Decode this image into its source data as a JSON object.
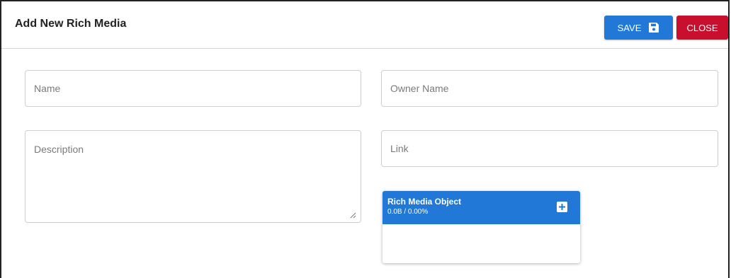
{
  "header": {
    "title": "Add New Rich Media",
    "save_label": "SAVE",
    "close_label": "CLOSE"
  },
  "form": {
    "name": {
      "placeholder": "Name",
      "value": ""
    },
    "owner_name": {
      "placeholder": "Owner Name",
      "value": ""
    },
    "description": {
      "placeholder": "Description",
      "value": ""
    },
    "link": {
      "placeholder": "Link",
      "value": ""
    }
  },
  "rich_media": {
    "title": "Rich Media Object",
    "stats": "0.0B / 0.00%"
  },
  "colors": {
    "primary": "#2178d6",
    "danger": "#c8102e"
  },
  "icons": {
    "save": "save-icon",
    "add": "plus-square-icon"
  }
}
